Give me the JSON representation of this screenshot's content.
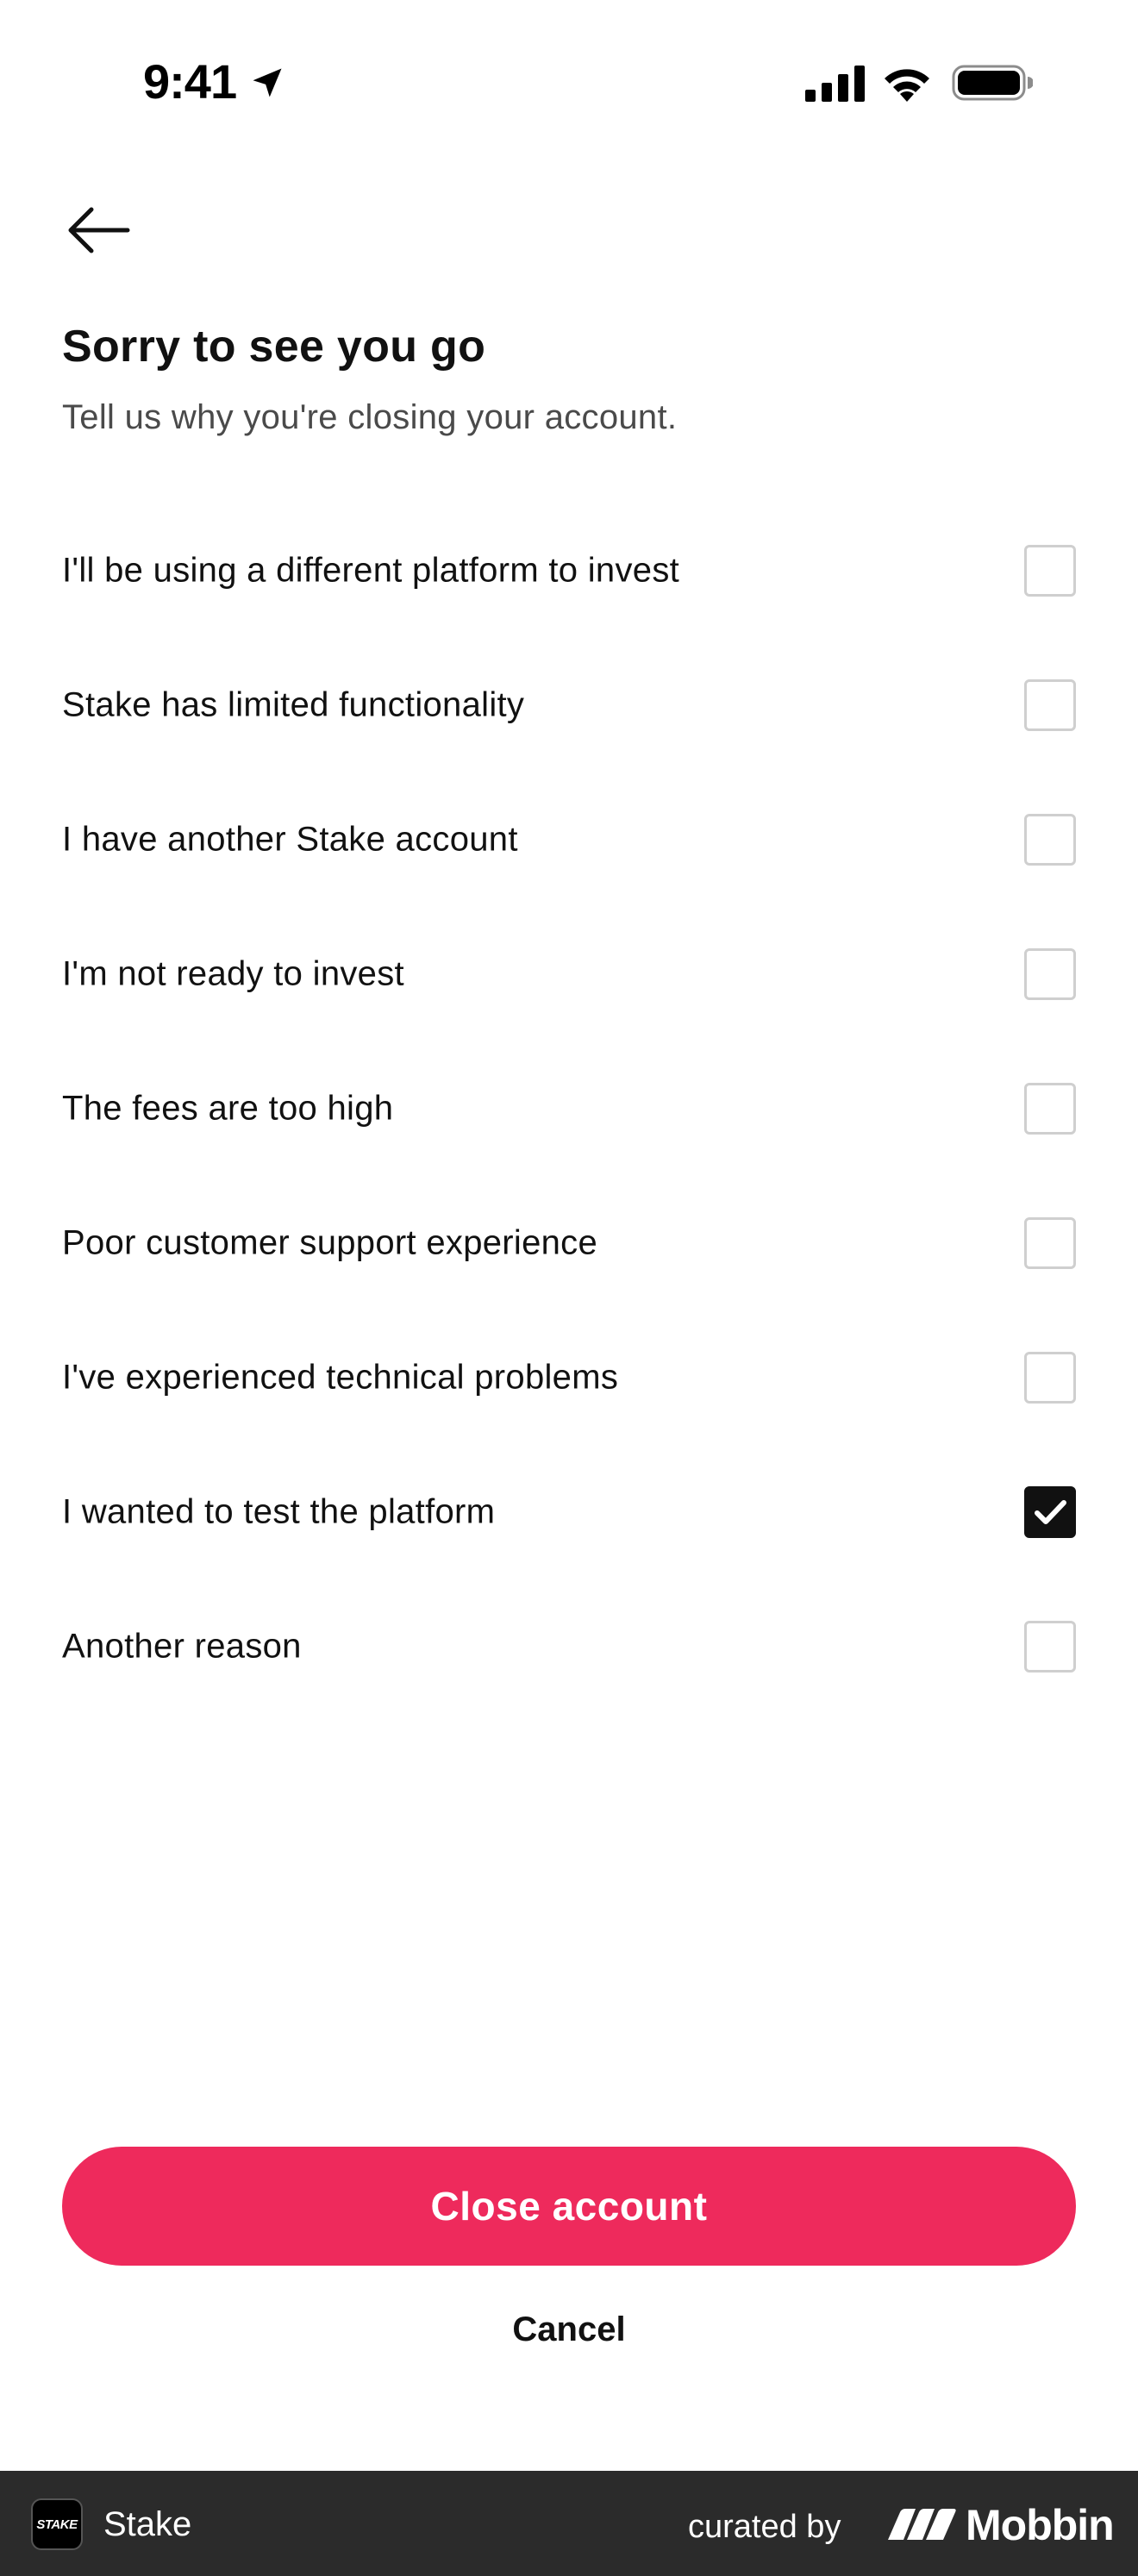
{
  "status_bar": {
    "time": "9:41",
    "icons": [
      "location-arrow-icon",
      "cellular-signal-icon",
      "wifi-icon",
      "battery-icon"
    ]
  },
  "header": {
    "back_icon": "arrow-left-icon"
  },
  "main": {
    "title": "Sorry to see you go",
    "subtitle": "Tell us why you're closing your account.",
    "reasons": [
      {
        "label": "I'll be using a different platform to invest",
        "checked": false
      },
      {
        "label": "Stake has limited functionality",
        "checked": false
      },
      {
        "label": "I have another Stake account",
        "checked": false
      },
      {
        "label": "I'm not ready to invest",
        "checked": false
      },
      {
        "label": "The fees are too high",
        "checked": false
      },
      {
        "label": "Poor customer support experience",
        "checked": false
      },
      {
        "label": "I've experienced technical problems",
        "checked": false
      },
      {
        "label": "I wanted to test the platform",
        "checked": true
      },
      {
        "label": "Another reason",
        "checked": false
      }
    ]
  },
  "actions": {
    "close_label": "Close account",
    "cancel_label": "Cancel"
  },
  "footer": {
    "app_logo_text": "STAKE",
    "app_name": "Stake",
    "curated_by": "curated by",
    "brand": "Mobbin"
  },
  "colors": {
    "accent": "#ee2a5c",
    "checked": "#111111",
    "unchecked_border": "#cfcfcf",
    "footer_bg": "#2b2b2b"
  }
}
